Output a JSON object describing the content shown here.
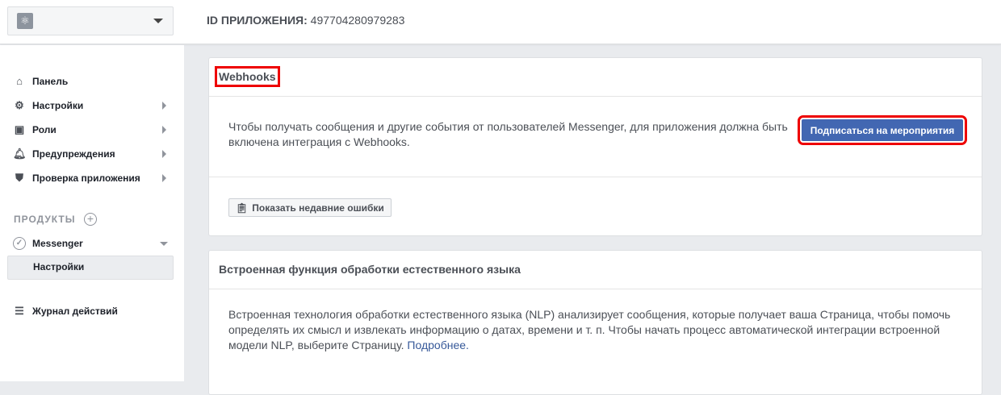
{
  "header": {
    "app_id_label": "ID ПРИЛОЖЕНИЯ:",
    "app_id": "497704280979283"
  },
  "sidebar": {
    "items": [
      {
        "label": "Панель",
        "icon": "home-icon"
      },
      {
        "label": "Настройки",
        "icon": "gear-icon"
      },
      {
        "label": "Роли",
        "icon": "roles-icon"
      },
      {
        "label": "Предупреждения",
        "icon": "bell-icon"
      },
      {
        "label": "Проверка приложения",
        "icon": "shield-icon"
      }
    ],
    "products_label": "ПРОДУКТЫ",
    "messenger_label": "Messenger",
    "messenger_sub": "Настройки",
    "activity_log": "Журнал действий"
  },
  "webhooks": {
    "title": "Webhooks",
    "text": "Чтобы получать сообщения и другие события от пользователей Messenger, для приложения должна быть включена интеграция с Webhooks.",
    "subscribe_button": "Подписаться на мероприятия",
    "errors_button": "Показать недавние ошибки"
  },
  "nlp": {
    "title": "Встроенная функция обработки естественного языка",
    "text": "Встроенная технология обработки естественного языка (NLP) анализирует сообщения, которые получает ваша Страница, чтобы помочь определять их смысл и извлекать информацию о датах, времени и т. п. Чтобы начать процесс автоматической интеграции встроенной модели NLP, выберите Страницу.",
    "link": "Подробнее."
  }
}
